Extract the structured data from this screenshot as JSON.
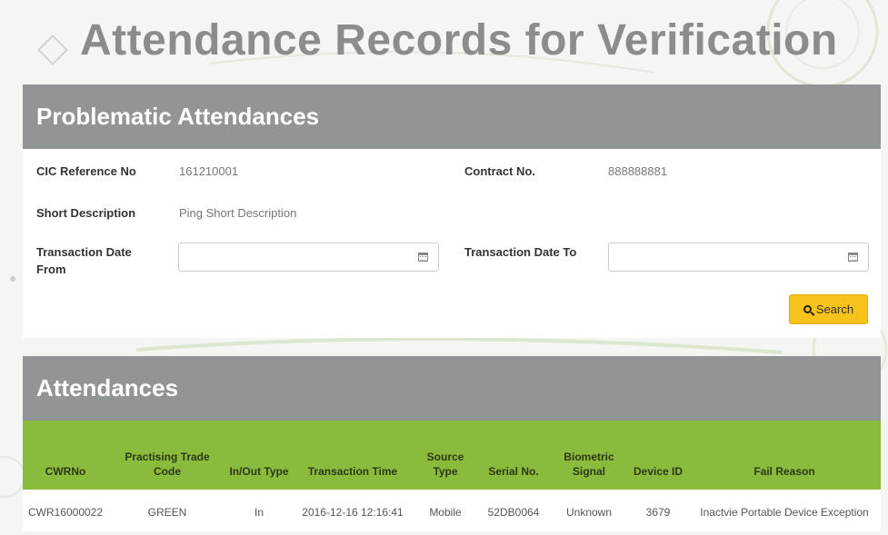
{
  "page": {
    "title": "Attendance Records for Verification"
  },
  "problem_panel": {
    "title": "Problematic Attendances",
    "cic_label": "CIC Reference No",
    "cic_value": "161210001",
    "contract_label": "Contract No.",
    "contract_value": "888888881",
    "short_desc_label": "Short Description",
    "short_desc_value": "Ping Short Description",
    "date_from_label": "Transaction Date From",
    "date_from_value": "",
    "date_to_label": "Transaction Date To",
    "date_to_value": "",
    "search_label": "Search"
  },
  "attendances": {
    "title": "Attendances",
    "columns": [
      "CWRNo",
      "Practising Trade Code",
      "In/Out Type",
      "Transaction Time",
      "Source Type",
      "Serial No.",
      "Biometric Signal",
      "Device ID",
      "Fail Reason"
    ],
    "rows": [
      [
        "CWR16000022",
        "GREEN",
        "In",
        "2016-12-16 12:16:41",
        "Mobile",
        "52DB0064",
        "Unknown",
        "3679",
        "Inactvie Portable Device Exception"
      ]
    ]
  },
  "icons": {
    "title": "diamond-icon",
    "calendar": "calendar-icon",
    "search": "search-icon"
  },
  "colors": {
    "panel_header": "#929596",
    "table_header": "#8bbb3c",
    "search_button": "#f7c21a",
    "title_text": "#8a8d8c"
  }
}
